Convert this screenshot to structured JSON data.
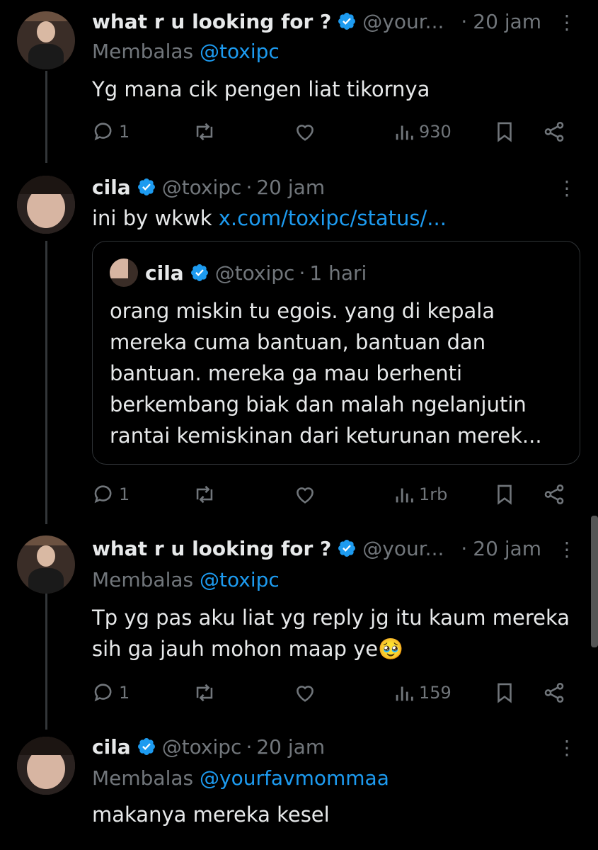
{
  "tweets": [
    {
      "name": "what r u looking for ?",
      "handle": "@your...",
      "sep": "·",
      "time": "20 jam",
      "reply_prefix": "Membalas",
      "reply_to": "@toxipc",
      "text_lines": [
        "Yg mana cik pengen liat tikornya"
      ],
      "replies": "1",
      "views": "930"
    },
    {
      "name": "cila",
      "handle": "@toxipc",
      "sep": "·",
      "time": "20 jam",
      "text_prefix": "ini by wkwk ",
      "text_link": "x.com/toxipc/status/...",
      "quote": {
        "name": "cila",
        "handle": "@toxipc",
        "sep": "·",
        "time": "1 hari",
        "text_lines": [
          "orang miskin tu egois. yang di kepala",
          "mereka cuma bantuan, bantuan dan",
          "bantuan. mereka ga mau berhenti",
          "berkembang biak dan malah ngelanjutin",
          "rantai kemiskinan dari keturunan merek..."
        ]
      },
      "replies": "1",
      "views": "1rb"
    },
    {
      "name": "what r u looking for ?",
      "handle": "@your...",
      "sep": "·",
      "time": "20 jam",
      "reply_prefix": "Membalas",
      "reply_to": "@toxipc",
      "text_lines": [
        "Tp yg pas aku liat yg reply jg itu kaum mereka",
        "sih ga jauh mohon maap ye🥹"
      ],
      "replies": "1",
      "views": "159"
    },
    {
      "name": "cila",
      "handle": "@toxipc",
      "sep": "·",
      "time": "20 jam",
      "reply_prefix": "Membalas",
      "reply_to": "@yourfavmommaa",
      "text_lines": [
        "makanya mereka kesel"
      ]
    }
  ],
  "icons": {
    "verified": "verified-badge-icon",
    "more": "more-dots-icon",
    "reply": "reply-icon",
    "retweet": "retweet-icon",
    "like": "like-icon",
    "views": "views-icon",
    "bookmark": "bookmark-icon",
    "share": "share-icon"
  },
  "colors": {
    "link": "#1d9bf0",
    "muted": "#71767b",
    "background": "#000000",
    "text": "#e7e9ea"
  }
}
